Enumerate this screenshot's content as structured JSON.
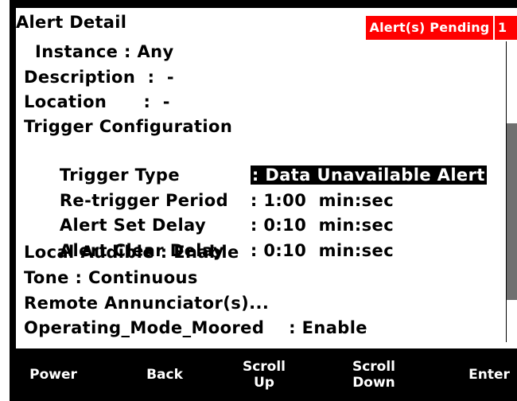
{
  "screen": {
    "title": "Alert Detail",
    "badge_label": "Alert(s) Pending",
    "badge_count": "1",
    "colors": {
      "badge_bg": "#ff0000",
      "scroll_thumb": "#707070",
      "highlight_bg": "#000000"
    }
  },
  "rows": {
    "instance": "Instance : Any",
    "description": "Description  :  -",
    "location": "Location      :  -",
    "trigger_config": "Trigger Configuration",
    "trigger_type_label": "Trigger Type",
    "trigger_type_value": ": Data Unavailable Alert",
    "retrigger_label": "Re-trigger Period",
    "retrigger_value": ": 1:00  min:sec",
    "set_delay_label": "Alert Set Delay",
    "set_delay_value": ": 0:10  min:sec",
    "clear_delay_label": "Alert Clear Delay",
    "clear_delay_value": ": 0:10  min:sec",
    "local_audible": "Local Audible : Enable",
    "tone": "Tone : Continuous",
    "remote": "Remote Annunciator(s)...",
    "operating_mode": "Operating_Mode_Moored    : Enable"
  },
  "softkeys": {
    "power": "Power",
    "back": "Back",
    "scroll_up_1": "Scroll",
    "scroll_up_2": "Up",
    "scroll_down_1": "Scroll",
    "scroll_down_2": "Down",
    "enter": "Enter"
  },
  "scrollbar": {
    "thumb_fraction": 0.59
  }
}
